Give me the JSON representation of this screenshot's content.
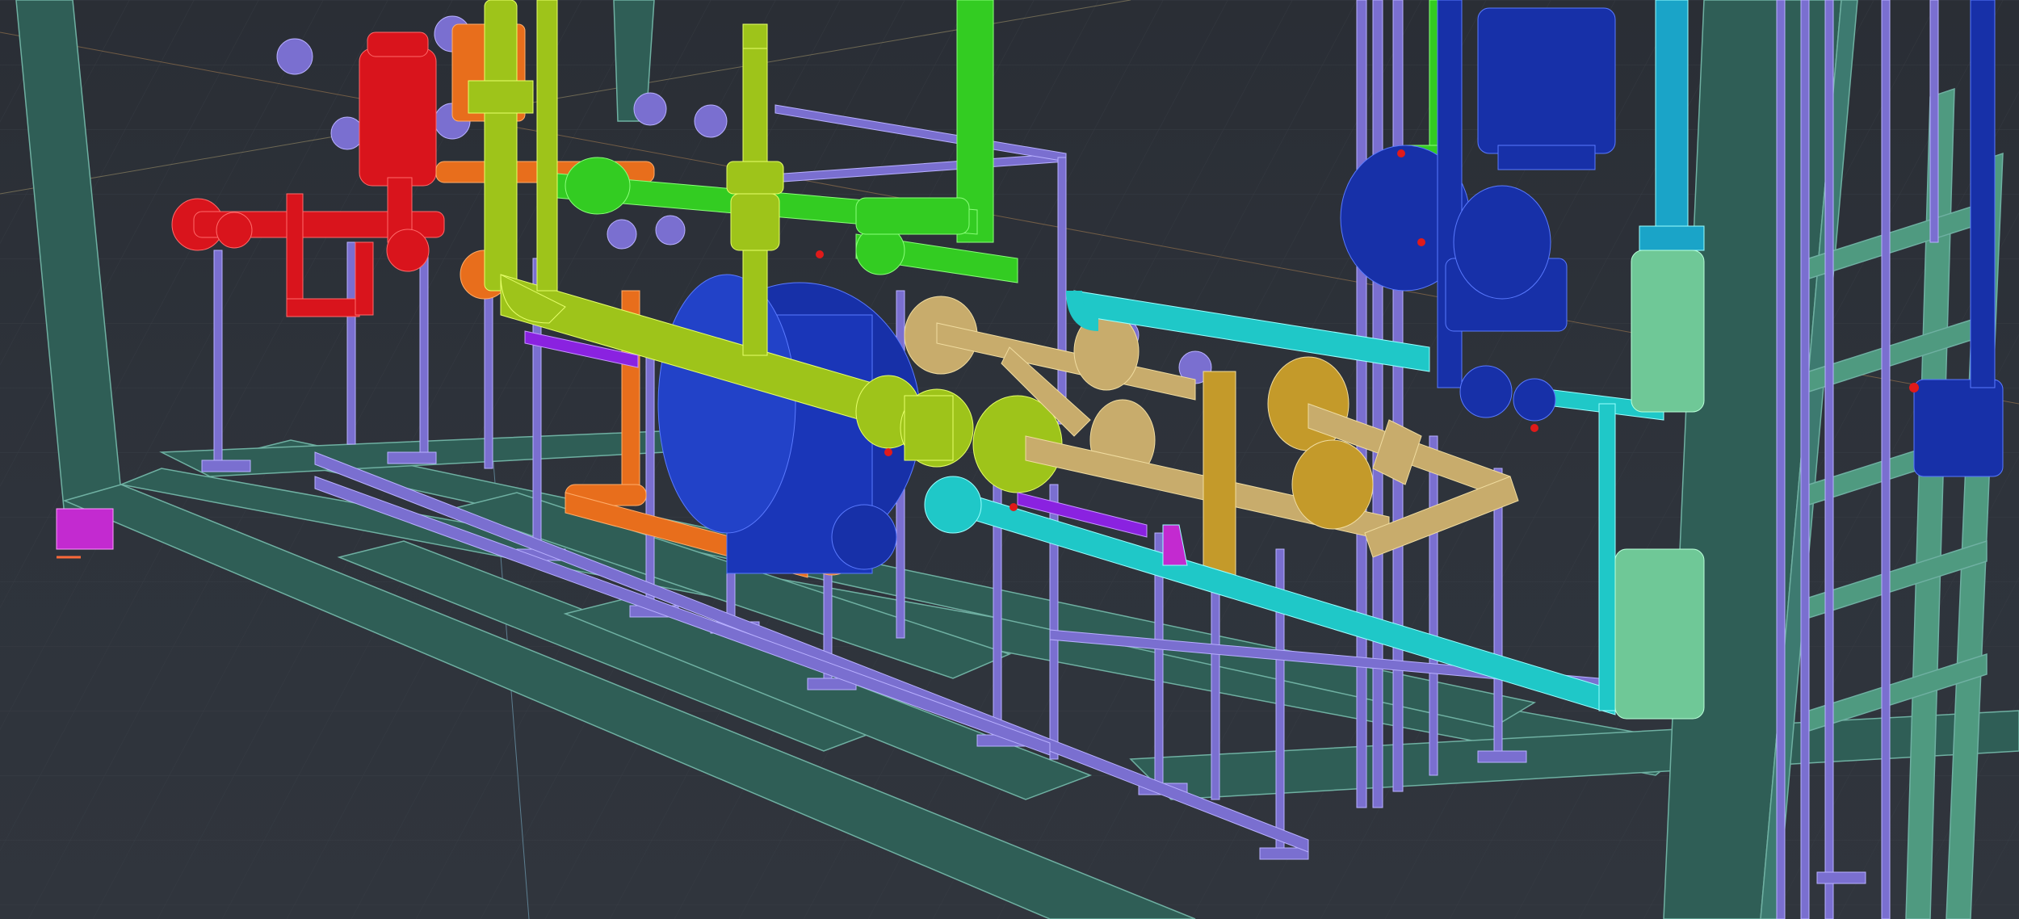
{
  "viewport": {
    "background": "#2c3038",
    "grid_color": "#3a3f47",
    "frame_color": "#2f5e56",
    "frame_edge": "#6fb0a2"
  },
  "colors": {
    "purple_supports": "#7a6fd0",
    "red_line": "#d9141c",
    "orange_line": "#e86e1c",
    "yellow_green_line": "#9ec41a",
    "green_line": "#33cc22",
    "dark_blue_vessel": "#1730a8",
    "tan_line": "#c8ac6c",
    "gold_valves": "#c49a2a",
    "cyan_line": "#1fc8c8",
    "teal_line": "#1aa4c8",
    "mint_boxes": "#6fc897",
    "magenta_marker": "#c32ad0",
    "violet_line": "#8a22e0"
  }
}
